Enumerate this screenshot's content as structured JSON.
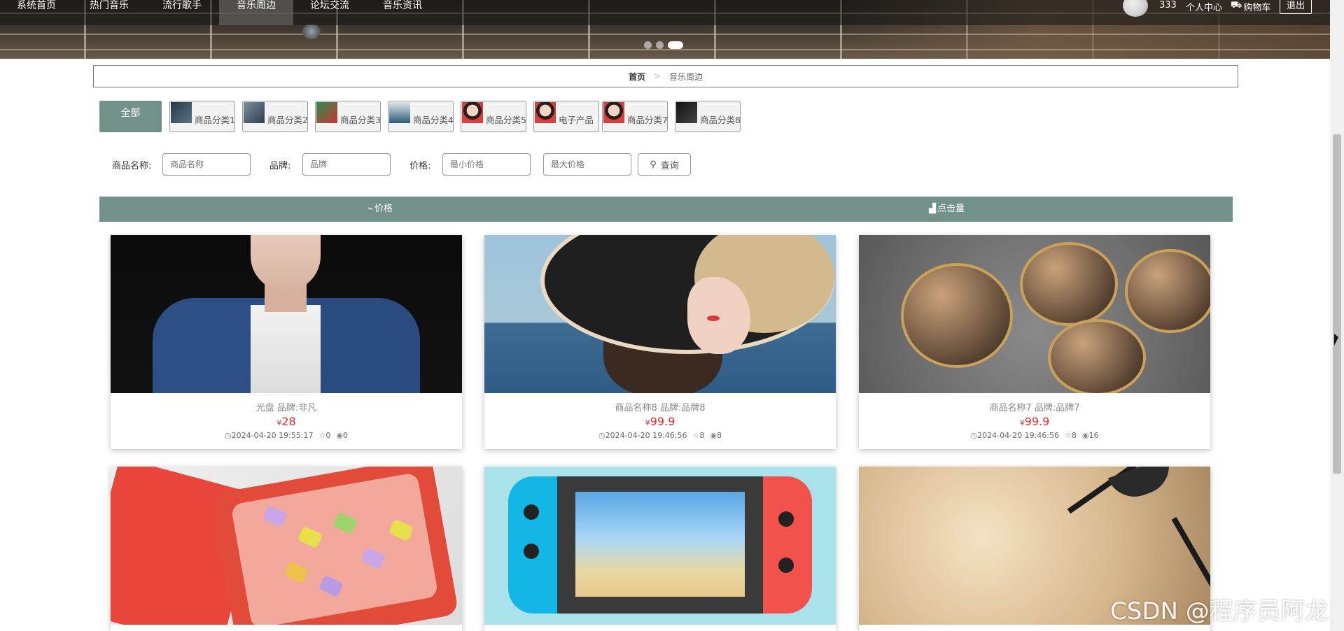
{
  "nav": {
    "items": [
      "系统首页",
      "热门音乐",
      "流行歌手",
      "音乐周边",
      "论坛交流",
      "音乐资讯"
    ],
    "active_index": 3,
    "username": "333",
    "center_label": "个人中心",
    "cart_label": "购物车",
    "logout_label": "退出"
  },
  "carousel": {
    "dots": 3,
    "active": 2
  },
  "breadcrumb": {
    "home": "首页",
    "separator": ">",
    "current": "音乐周边"
  },
  "categories": {
    "all_label": "全部",
    "items": [
      "商品分类1",
      "商品分类2",
      "商品分类3",
      "商品分类4",
      "商品分类5",
      "电子产品",
      "商品分类7",
      "商品分类8"
    ]
  },
  "search": {
    "name_label": "商品名称:",
    "name_placeholder": "商品名称",
    "brand_label": "品牌:",
    "brand_placeholder": "品牌",
    "price_label": "价格:",
    "min_placeholder": "最小价格",
    "max_placeholder": "最大价格",
    "button_label": "查询"
  },
  "sort": {
    "price_label": "价格",
    "clicks_label": "点击量"
  },
  "products": [
    {
      "title": "光盘  品牌:非凡",
      "price": "28",
      "time": "2024-04-20 19:55:17",
      "stars": "0",
      "views": "0"
    },
    {
      "title": "商品名称8  品牌:品牌8",
      "price": "99.9",
      "time": "2024-04-20 19:46:56",
      "stars": "8",
      "views": "8"
    },
    {
      "title": "商品名称7  品牌:品牌7",
      "price": "99.9",
      "time": "2024-04-20 19:46:56",
      "stars": "8",
      "views": "16"
    }
  ],
  "currency_symbol": "¥",
  "watermark": "CSDN @程序员阿龙",
  "colors": {
    "accent": "#72918a",
    "price": "#e2302e"
  }
}
